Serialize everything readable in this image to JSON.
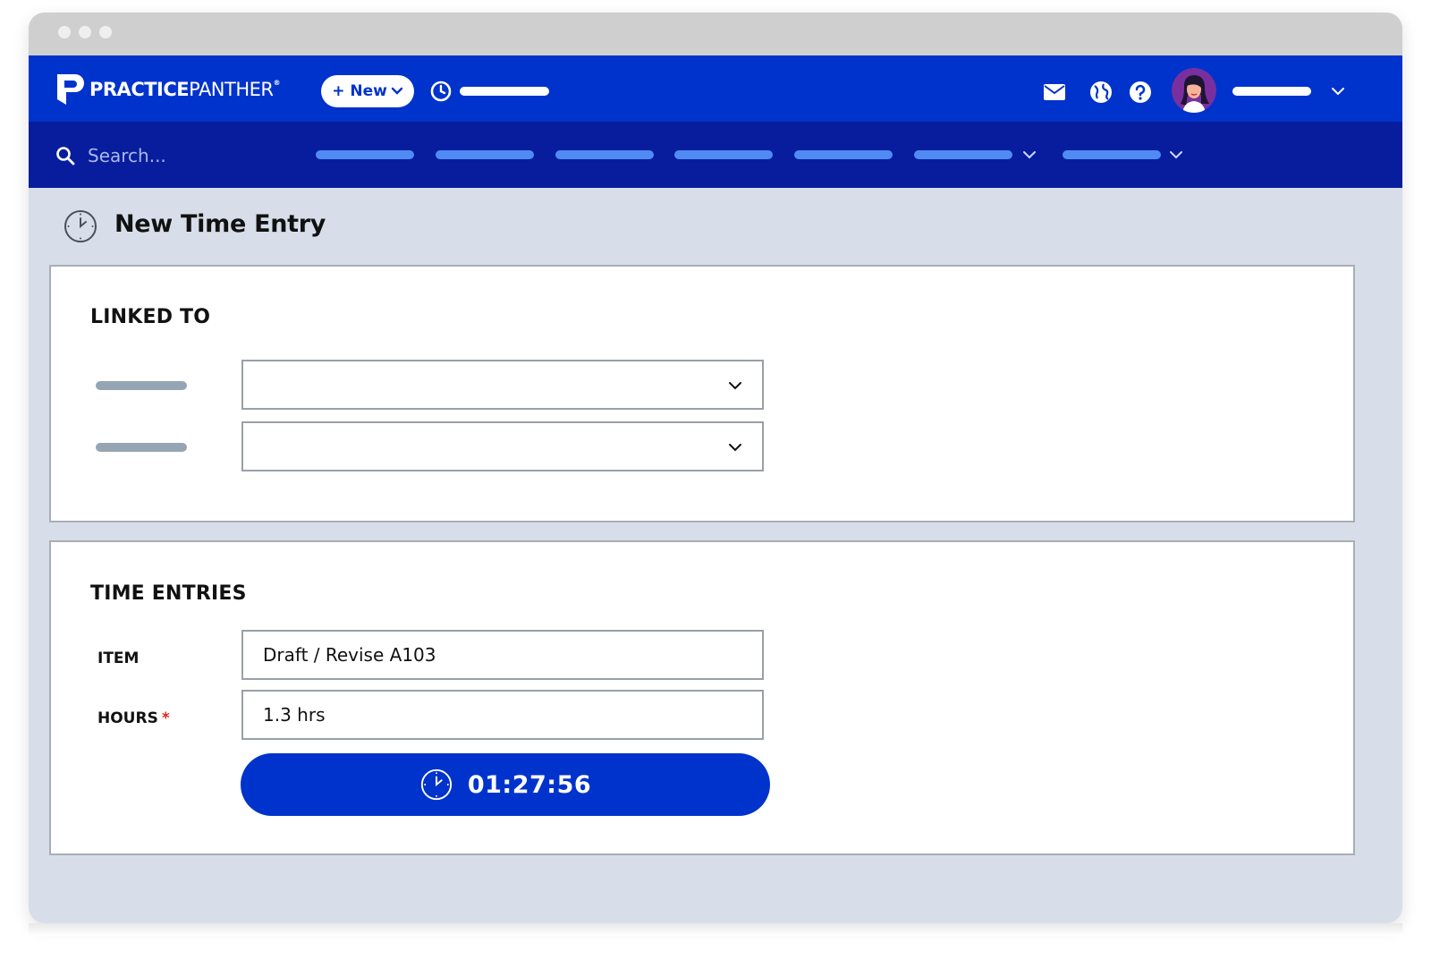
{
  "brand": {
    "name_bold": "PRACTICE",
    "name_light": "PANTHER",
    "trademark": "®"
  },
  "topbar": {
    "new_button_label": "+ New"
  },
  "search": {
    "placeholder": "Search..."
  },
  "page": {
    "title": "New Time Entry"
  },
  "linked_to": {
    "heading": "LINKED TO"
  },
  "time_entries": {
    "heading": "TIME ENTRIES",
    "item_label": "ITEM",
    "item_value": "Draft / Revise A103",
    "hours_label": "HOURS",
    "hours_required_mark": "*",
    "hours_value": "1.3 hrs",
    "timer_value": "01:27:56"
  },
  "colors": {
    "primary": "#0033cc",
    "nav": "#071d9e",
    "nav_pill": "#4f8bf3",
    "background": "#d8dee9",
    "required": "#e0261b"
  },
  "icons": [
    "panther-logo-icon",
    "timer-icon",
    "mail-icon",
    "globe-icon",
    "help-icon",
    "search-icon",
    "chevron-down-icon",
    "clock-icon"
  ]
}
